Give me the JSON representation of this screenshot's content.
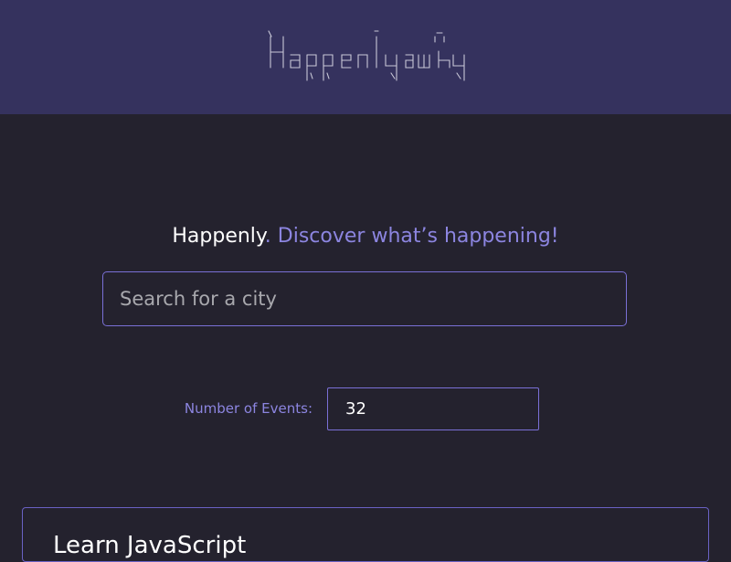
{
  "header": {
    "logo_text": "Happenly",
    "logo_icon": "ascii-art-wordmark"
  },
  "tagline": {
    "brand": "Happenly",
    "separator": ". ",
    "message": "Discover what’s happening!"
  },
  "search": {
    "placeholder": "Search for a city",
    "value": ""
  },
  "events_count": {
    "label": "Number of Events:",
    "value": "32"
  },
  "events": [
    {
      "title": "Learn JavaScript"
    }
  ],
  "colors": {
    "header_bg": "#35325e",
    "page_bg": "#24222e",
    "accent": "#8c85e0",
    "border": "#7a70d6"
  }
}
